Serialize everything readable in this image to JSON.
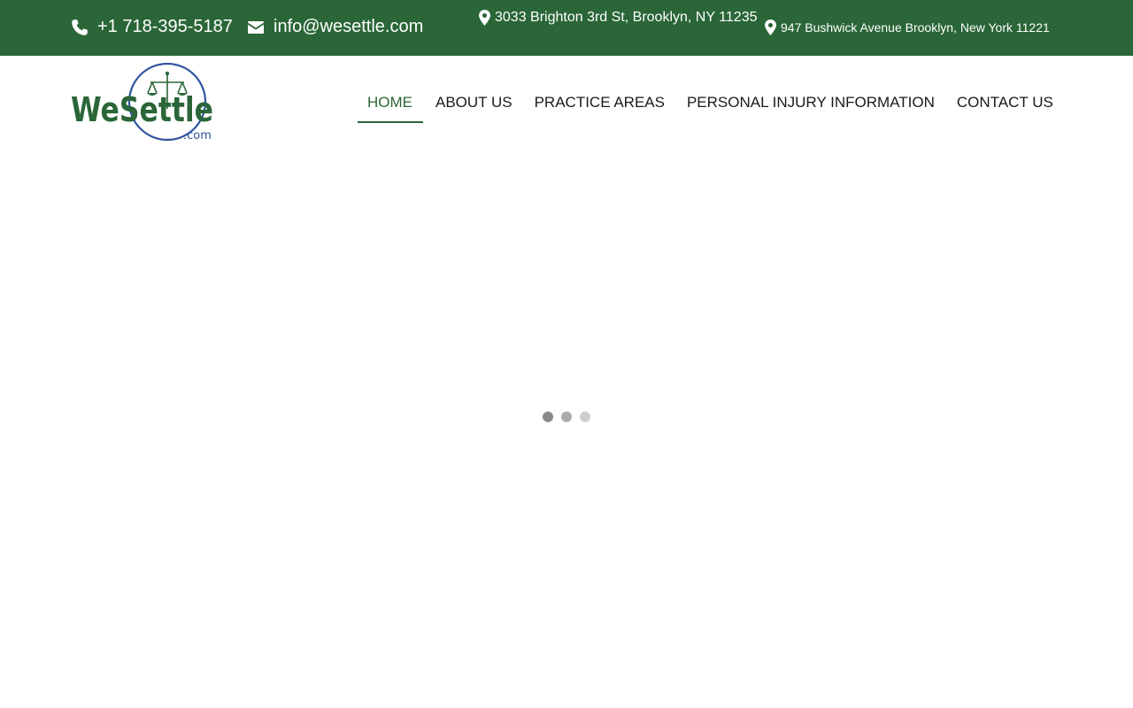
{
  "topbar": {
    "phone": "+1 718-395-5187",
    "email": "info@wesettle.com",
    "address_1": "3033 Brighton 3rd St, Brooklyn, NY 11235",
    "address_2": "947 Bushwick Avenue Brooklyn, New York 11221",
    "icons": {
      "phone": "phone-icon",
      "email": "envelope-icon",
      "address": "map-marker-icon"
    },
    "background_color": "#2a6637"
  },
  "logo": {
    "wordmark": "WeSettle",
    "suffix": ".com",
    "primary_color": "#2a6637",
    "accent_color": "#2f54a0"
  },
  "nav": {
    "items": [
      {
        "label": "HOME",
        "active": true
      },
      {
        "label": "ABOUT US",
        "active": false
      },
      {
        "label": "PRACTICE AREAS",
        "active": false
      },
      {
        "label": "PERSONAL INJURY INFORMATION",
        "active": false
      },
      {
        "label": "CONTACT US",
        "active": false
      }
    ],
    "active_color": "#2a6637"
  },
  "loader": {
    "dots": 3
  }
}
